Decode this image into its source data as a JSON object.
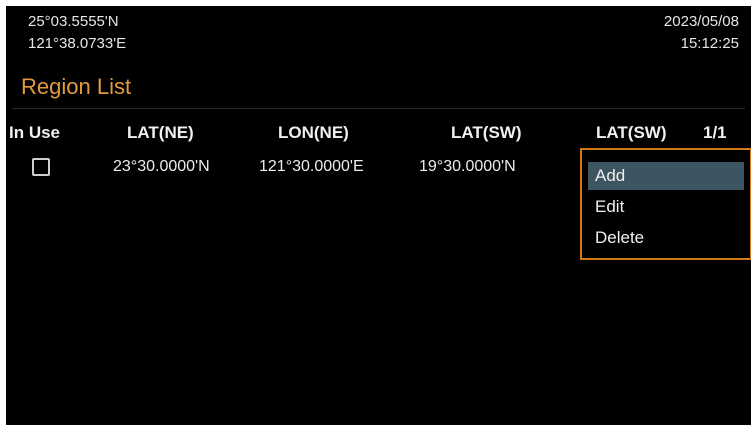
{
  "header": {
    "latitude": "25°03.5555'N",
    "longitude": "121°38.0733'E",
    "date": "2023/05/08",
    "time": "15:12:25"
  },
  "page": {
    "title": "Region List",
    "page_indicator": "1/1"
  },
  "table": {
    "columns": [
      "In Use",
      "LAT(NE)",
      "LON(NE)",
      "LAT(SW)",
      "LAT(SW)"
    ],
    "rows": [
      {
        "in_use": false,
        "lat_ne": "23°30.0000'N",
        "lon_ne": "121°30.0000'E",
        "lat_sw": "19°30.0000'N"
      }
    ]
  },
  "menu": {
    "items": [
      "Add",
      "Edit",
      "Delete"
    ],
    "selected": "Add"
  },
  "colors": {
    "accent": "#e39a3c",
    "menu_border": "#d27a18",
    "selection": "#3d5560",
    "background": "#000000"
  }
}
